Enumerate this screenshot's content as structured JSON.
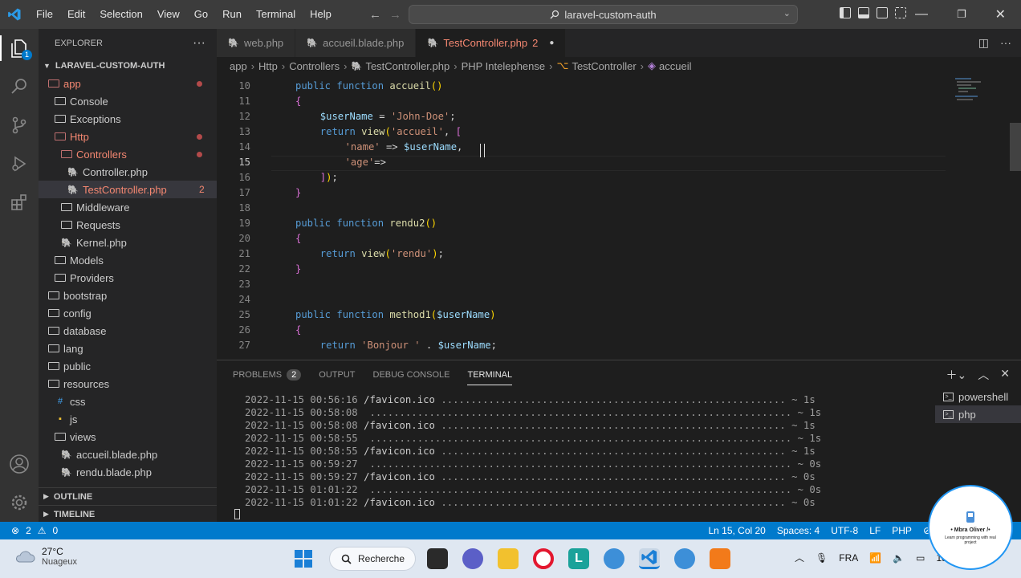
{
  "titlebar": {
    "menu": [
      "File",
      "Edit",
      "Selection",
      "View",
      "Go",
      "Run",
      "Terminal",
      "Help"
    ],
    "command_center": "laravel-custom-auth"
  },
  "activitybar": {
    "explorer_badge": "1",
    "icons": [
      "files-icon",
      "search-icon",
      "source-control-icon",
      "run-debug-icon",
      "extensions-icon",
      "account-icon",
      "gear-icon"
    ]
  },
  "sidebar": {
    "header": "EXPLORER",
    "header_actions": "···",
    "project": "LARAVEL-CUSTOM-AUTH",
    "tree": [
      {
        "label": "app",
        "type": "folder",
        "red": true,
        "dot": true
      },
      {
        "label": "Console",
        "type": "folder"
      },
      {
        "label": "Exceptions",
        "type": "folder"
      },
      {
        "label": "Http",
        "type": "folder",
        "red": true,
        "dot": true
      },
      {
        "label": "Controllers",
        "type": "folder",
        "red": true,
        "dot": true
      },
      {
        "label": "Controller.php",
        "type": "php"
      },
      {
        "label": "TestController.php",
        "type": "php",
        "red": true,
        "count": "2",
        "selected": true
      },
      {
        "label": "Middleware",
        "type": "folder"
      },
      {
        "label": "Requests",
        "type": "folder"
      },
      {
        "label": "Kernel.php",
        "type": "php"
      },
      {
        "label": "Models",
        "type": "folder"
      },
      {
        "label": "Providers",
        "type": "folder"
      },
      {
        "label": "bootstrap",
        "type": "folder"
      },
      {
        "label": "config",
        "type": "folder"
      },
      {
        "label": "database",
        "type": "folder"
      },
      {
        "label": "lang",
        "type": "folder"
      },
      {
        "label": "public",
        "type": "folder"
      },
      {
        "label": "resources",
        "type": "folder"
      },
      {
        "label": "css",
        "type": "css"
      },
      {
        "label": "js",
        "type": "js"
      },
      {
        "label": "views",
        "type": "folder"
      },
      {
        "label": "accueil.blade.php",
        "type": "php"
      },
      {
        "label": "rendu.blade.php",
        "type": "php"
      }
    ],
    "outline": "OUTLINE",
    "timeline": "TIMELINE"
  },
  "tabs": [
    {
      "label": "web.php",
      "active": false
    },
    {
      "label": "accueil.blade.php",
      "active": false
    },
    {
      "label": "TestController.php",
      "badge": "2",
      "active": true,
      "modified": true
    }
  ],
  "breadcrumb": [
    "app",
    "Http",
    "Controllers",
    "TestController.php",
    "PHP Intelephense",
    "TestController",
    "accueil"
  ],
  "code": {
    "current_line": 15,
    "lines": [
      {
        "n": "10",
        "text": "public function accueil()"
      },
      {
        "n": "11",
        "text": "{"
      },
      {
        "n": "12",
        "text": "$userName = 'John-Doe';"
      },
      {
        "n": "13",
        "text": "return view('accueil', ["
      },
      {
        "n": "14",
        "text": "'name' => $userName,"
      },
      {
        "n": "15",
        "text": "'age'=>"
      },
      {
        "n": "16",
        "text": "]);"
      },
      {
        "n": "17",
        "text": "}"
      },
      {
        "n": "18",
        "text": ""
      },
      {
        "n": "19",
        "text": "public function rendu2()"
      },
      {
        "n": "20",
        "text": "{"
      },
      {
        "n": "21",
        "text": "return view('rendu');"
      },
      {
        "n": "22",
        "text": "}"
      },
      {
        "n": "23",
        "text": ""
      },
      {
        "n": "24",
        "text": ""
      },
      {
        "n": "25",
        "text": "public function method1($userName)"
      },
      {
        "n": "26",
        "text": "{"
      },
      {
        "n": "27",
        "text": "return 'Bonjour ' . $userName;"
      }
    ]
  },
  "panel": {
    "tabs": [
      {
        "label": "PROBLEMS",
        "badge": "2"
      },
      {
        "label": "OUTPUT"
      },
      {
        "label": "DEBUG CONSOLE"
      },
      {
        "label": "TERMINAL",
        "active": true
      }
    ],
    "terminal_lines": [
      {
        "date": "2022-11-15 00:56:16",
        "path": "/favicon.ico",
        "dots": " .......................................................... ",
        "dur": "~ 1s"
      },
      {
        "date": "2022-11-15 00:58:08",
        "path": "",
        "dots": " ....................................................................... ",
        "dur": "~ 1s"
      },
      {
        "date": "2022-11-15 00:58:08",
        "path": "/favicon.ico",
        "dots": " .......................................................... ",
        "dur": "~ 1s"
      },
      {
        "date": "2022-11-15 00:58:55",
        "path": "",
        "dots": " ....................................................................... ",
        "dur": "~ 1s"
      },
      {
        "date": "2022-11-15 00:58:55",
        "path": "/favicon.ico",
        "dots": " .......................................................... ",
        "dur": "~ 1s"
      },
      {
        "date": "2022-11-15 00:59:27",
        "path": "",
        "dots": " ....................................................................... ",
        "dur": "~ 0s"
      },
      {
        "date": "2022-11-15 00:59:27",
        "path": "/favicon.ico",
        "dots": " .......................................................... ",
        "dur": "~ 0s"
      },
      {
        "date": "2022-11-15 01:01:22",
        "path": "",
        "dots": " ....................................................................... ",
        "dur": "~ 0s"
      },
      {
        "date": "2022-11-15 01:01:22",
        "path": "/favicon.ico",
        "dots": " .......................................................... ",
        "dur": "~ 0s"
      }
    ],
    "terminals": [
      {
        "label": "powershell"
      },
      {
        "label": "php",
        "selected": true
      }
    ]
  },
  "statusbar": {
    "errors": "2",
    "warnings": "0",
    "position": "Ln 15, Col 20",
    "spaces": "Spaces: 4",
    "encoding": "UTF-8",
    "eol": "LF",
    "language": "PHP"
  },
  "taskbar": {
    "temperature": "27°C",
    "weather": "Nuageux",
    "search_label": "Recherche",
    "language": "FRA",
    "clock": "15/"
  },
  "watermark": {
    "name": "• Mbra Oliver /•",
    "tagline": "Learn programming with real project"
  },
  "colors": {
    "accent": "#007acc",
    "error": "#f48771"
  }
}
